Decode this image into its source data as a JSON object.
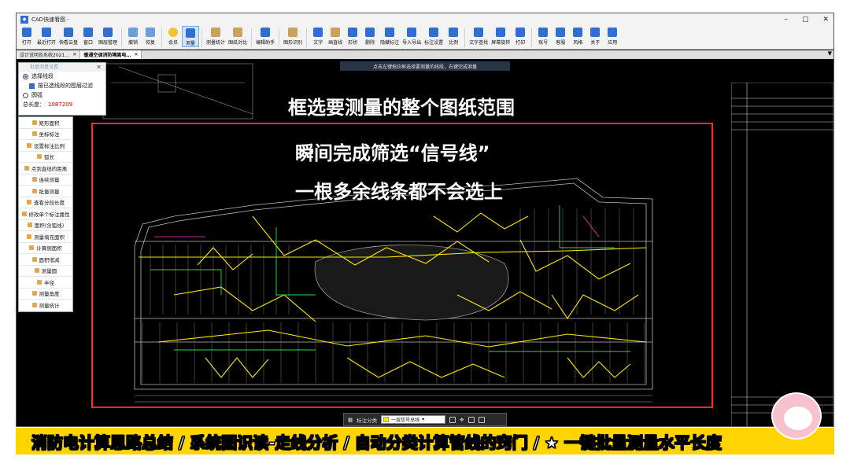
{
  "window": {
    "title": "CAD快速看图 -",
    "controls": [
      "–",
      "▢",
      "✕"
    ]
  },
  "toolbar": [
    {
      "label": "打开",
      "icon": "folder-open-icon",
      "color": "#2f6fd1"
    },
    {
      "label": "最近打开",
      "icon": "history-icon",
      "color": "#2f6fd1"
    },
    {
      "label": "快看云盘",
      "icon": "cloud-icon",
      "color": "#2f6fd1"
    },
    {
      "label": "窗口",
      "icon": "window-icon",
      "color": "#2f6fd1"
    },
    {
      "label": "图层管理",
      "icon": "layers-icon",
      "color": "#2f6fd1"
    },
    {
      "label": "撤销",
      "icon": "undo-icon",
      "color": "#6aa0e0"
    },
    {
      "label": "恢复",
      "icon": "redo-icon",
      "color": "#6aa0e0"
    },
    {
      "label": "会员",
      "icon": "vip-icon",
      "color": "#f1c232"
    },
    {
      "label": "测量",
      "icon": "measure-icon",
      "color": "#2f6fd1"
    },
    {
      "label": "测量统计",
      "icon": "measure-stats-icon",
      "color": "#c9a35c"
    },
    {
      "label": "图纸对比",
      "icon": "compare-icon",
      "color": "#c9a35c"
    },
    {
      "label": "编辑助手",
      "icon": "edit-assistant-icon",
      "color": "#2f6fd1"
    },
    {
      "label": "图形识别",
      "icon": "shape-recognize-icon",
      "color": "#c9a35c"
    },
    {
      "label": "文字",
      "icon": "text-icon",
      "color": "#2f6fd1"
    },
    {
      "label": "画直线",
      "icon": "line-icon",
      "color": "#c9a35c"
    },
    {
      "label": "形状",
      "icon": "shape-icon",
      "color": "#2f6fd1"
    },
    {
      "label": "删除",
      "icon": "erase-icon",
      "color": "#2f6fd1"
    },
    {
      "label": "隐藏标注",
      "icon": "hide-icon",
      "color": "#2f6fd1"
    },
    {
      "label": "导入导出",
      "icon": "import-export-icon",
      "color": "#2f6fd1"
    },
    {
      "label": "标注设置",
      "icon": "annotation-settings-icon",
      "color": "#2f6fd1"
    },
    {
      "label": "比例",
      "icon": "scale-icon",
      "color": "#2f6fd1"
    },
    {
      "label": "文字查找",
      "icon": "text-search-icon",
      "color": "#2f6fd1"
    },
    {
      "label": "屏幕旋转",
      "icon": "rotate-screen-icon",
      "color": "#2f6fd1"
    },
    {
      "label": "打印",
      "icon": "print-icon",
      "color": "#2f6fd1"
    },
    {
      "label": "账号",
      "icon": "account-icon",
      "color": "#2f6fd1"
    },
    {
      "label": "客服",
      "icon": "headset-icon",
      "color": "#2f6fd1"
    },
    {
      "label": "风格",
      "icon": "style-icon",
      "color": "#2f6fd1"
    },
    {
      "label": "关于",
      "icon": "info-icon",
      "color": "#2f6fd1"
    },
    {
      "label": "应用",
      "icon": "apps-icon",
      "color": "#2f6fd1"
    }
  ],
  "tabs": [
    {
      "label": "设计说明及系统2021…",
      "active": false
    },
    {
      "label": "暖通空调消防隔离电…",
      "active": true
    }
  ],
  "hint": "点击左键拖拉框选择要测量的线段，右键完成测量",
  "panel": {
    "title": "批量测量设置",
    "option1": "选择线段",
    "option1_sub": "按已选线段的图层过滤",
    "option2": "圆弧",
    "total_label": "总长度：",
    "total_value": "1087209"
  },
  "commands": [
    "矩形面积",
    "坐标标注",
    "设置标注比例",
    "弧长",
    "点到直线的距离",
    "连续测量",
    "批量测量",
    "查看分段长度",
    "修改单个标注属性",
    "面积(含弧线)",
    "测量填充面积",
    "计算侧面积",
    "面积增减",
    "测量圆",
    "半径",
    "测量角度",
    "测量统计"
  ],
  "overlay": {
    "line1": "框选要测量的整个图纸范围",
    "line2": "瞬间完成筛选“信号线”",
    "line3": "一根多余线条都不会选上"
  },
  "bottom_bar": {
    "label": "标注分类",
    "layer_name": "一层信号总线",
    "layer_color": "#ffe800"
  },
  "caption": "消防电计算思路总结 / 系统图识读-走线分析 / 自动分类计算管线的窍门 / ★ 一键批量测量水平长度",
  "colors": {
    "caption_bg": "#ffd400",
    "selection": "#ff2a2a",
    "signal_line": "#ffe800",
    "green_line": "#39d353"
  }
}
